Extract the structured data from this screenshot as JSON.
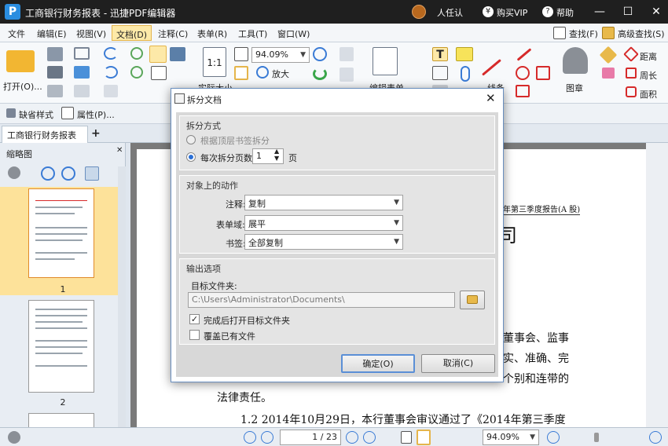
{
  "app": {
    "title": "工商银行财务报表 - 迅捷PDF编辑器",
    "user_label": "人任认",
    "vip_label": "购买VIP",
    "help_label": "帮助",
    "vip_symbol": "¥",
    "help_symbol": "?",
    "logo_letter": "P",
    "minimize_symbol": "—",
    "maximize_symbol": "☐",
    "close_symbol": "✕"
  },
  "menu": {
    "items": [
      "文件",
      "编辑(E)",
      "视图(V)",
      "文档(D)",
      "注释(C)",
      "表单(R)",
      "工具(T)",
      "窗口(W)"
    ],
    "active_index": 3,
    "find_label": "查找(F)",
    "advanced_find_label": "高级查找(S)"
  },
  "toolbar": {
    "open_label": "打开(O)...",
    "zoom_value": "94.09%",
    "actual_size_label": "实际大小",
    "zoom_in_label": "放大",
    "edit_form_label": "编辑表单",
    "line_label": "线条",
    "stamp_label": "图章",
    "distance_label": "距离",
    "perimeter_label": "周长",
    "area_label": "面积",
    "one_to_one": "1:1",
    "text_tool_letter": "T"
  },
  "propbar": {
    "style_label": "缺省样式",
    "properties_label": "属性(P)..."
  },
  "tabs": {
    "document_tab": "工商银行财务报表",
    "add_symbol": "+"
  },
  "leftpanel": {
    "header": "缩略图",
    "page1": "1",
    "page2": "2",
    "close_symbol": "✕"
  },
  "document": {
    "report_title": "年第三季度报告(A 股)",
    "line1": "董事会、监事",
    "line2": "实、准确、完",
    "line3": "个别和连带的",
    "line4": "法律责任。",
    "line5": "1.2 2014年10月29日，本行董事会审议通过了《2014年第三季度",
    "big_char": "司"
  },
  "statusbar": {
    "page_indicator": "1 / 23",
    "zoom_value": "94.09%"
  },
  "dialog": {
    "title": "拆分文档",
    "split_method_header": "拆分方式",
    "split_by_bookmark": "根据顶层书签拆分",
    "split_by_pages": "每次拆分页数",
    "pages_value": "1",
    "pages_unit": "页",
    "actions_header": "对象上的动作",
    "annotation_label": "注释:",
    "annotation_value": "复制",
    "form_field_label": "表单域:",
    "form_field_value": "展平",
    "bookmark_label": "书签:",
    "bookmark_value": "全部复制",
    "output_header": "输出选项",
    "target_folder_label": "目标文件夹:",
    "target_folder_value": "C:\\Users\\Administrator\\Documents\\",
    "open_folder_checkbox": "完成后打开目标文件夹",
    "overwrite_checkbox": "覆盖已有文件",
    "ok_button": "确定(O)",
    "cancel_button": "取消(C)",
    "close_symbol": "✕",
    "check_mark": "✓"
  },
  "colors": {
    "titlebar_bg": "#1f1f1f",
    "accent_blue": "#2a8de0",
    "active_menu_bg": "#fde9a8",
    "page_highlight": "#fde29a"
  }
}
